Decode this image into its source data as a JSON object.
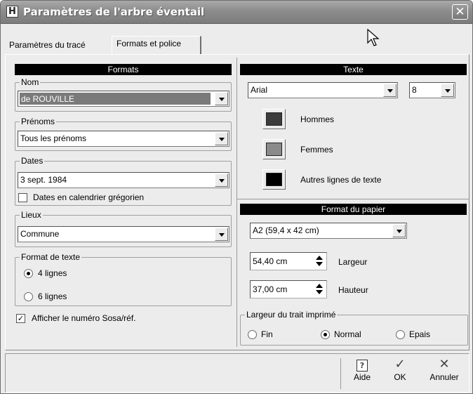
{
  "window": {
    "title": "Paramètres de l'arbre éventail",
    "app_icon": "H",
    "close_label": "✕"
  },
  "tabs": [
    {
      "label": "Paramètres du tracé",
      "active": false
    },
    {
      "label": "Formats et police",
      "active": true
    }
  ],
  "formats": {
    "header": "Formats",
    "nom": {
      "legend": "Nom",
      "value": "de ROUVILLE"
    },
    "prenoms": {
      "legend": "Prénoms",
      "value": "Tous les prénoms"
    },
    "dates": {
      "legend": "Dates",
      "value": "3 sept. 1984",
      "gregorian_label": "Dates en calendrier grégorien",
      "gregorian_checked": false
    },
    "lieux": {
      "legend": "Lieux",
      "value": "Commune"
    },
    "format_texte": {
      "legend": "Format de texte",
      "options": [
        "4 lignes",
        "6 lignes"
      ],
      "selected": "4 lignes"
    },
    "sosa_label": "Afficher le numéro Sosa/réf.",
    "sosa_checked": true
  },
  "texte": {
    "header": "Texte",
    "font": "Arial",
    "size": "8",
    "colors": [
      {
        "label": "Hommes",
        "color": "#3c3c3c"
      },
      {
        "label": "Femmes",
        "color": "#8a8a8a"
      },
      {
        "label": "Autres lignes de texte",
        "color": "#000000"
      }
    ]
  },
  "papier": {
    "header": "Format du papier",
    "format": "A2 (59,4 x 42  cm)",
    "largeur": {
      "value": "54,40 cm",
      "label": "Largeur"
    },
    "hauteur": {
      "value": "37,00 cm",
      "label": "Hauteur"
    }
  },
  "trait": {
    "legend": "Largeur du trait imprimé",
    "options": [
      "Fin",
      "Normal",
      "Epais"
    ],
    "selected": "Normal"
  },
  "actions": {
    "help": {
      "label": "Aide",
      "icon": "?"
    },
    "ok": {
      "label": "OK",
      "icon": "✓"
    },
    "cancel": {
      "label": "Annuler",
      "icon": "✕"
    }
  }
}
